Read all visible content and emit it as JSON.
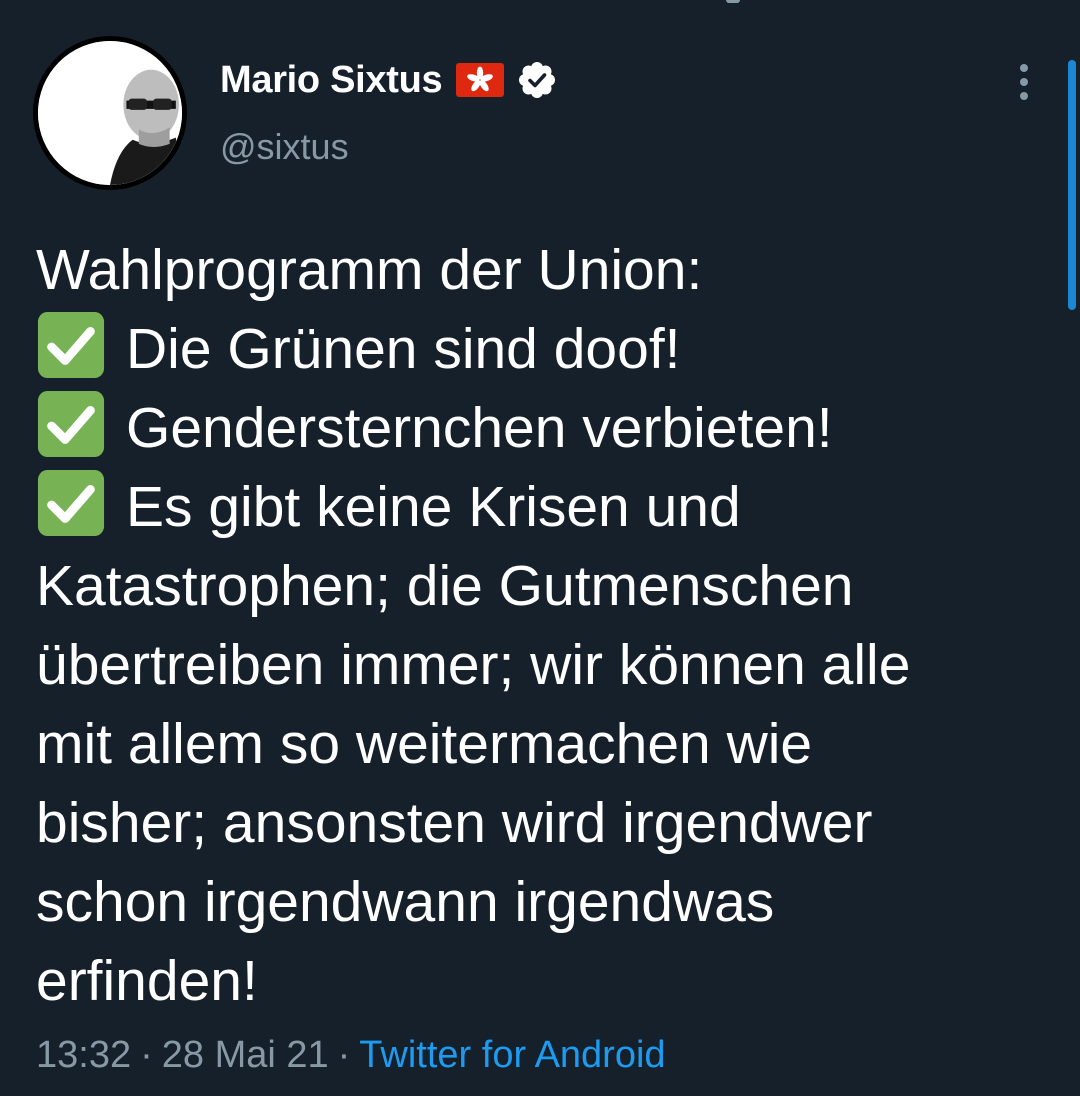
{
  "tweet": {
    "author": {
      "display_name": "Mario Sixtus",
      "handle": "@sixtus",
      "flag_icon": "hong-kong-flag-icon",
      "verified_icon": "verified-badge-icon"
    },
    "text_lines": [
      {
        "check": false,
        "text": "Wahlprogramm der Union:"
      },
      {
        "check": true,
        "text": "Die Grünen sind doof!"
      },
      {
        "check": true,
        "text": "Gendersternchen verbieten!"
      },
      {
        "check": true,
        "text": "Es gibt keine Krisen und"
      },
      {
        "check": false,
        "text": "Katastrophen; die Gutmenschen"
      },
      {
        "check": false,
        "text": "übertreiben immer; wir können alle"
      },
      {
        "check": false,
        "text": "mit allem so weitermachen wie"
      },
      {
        "check": false,
        "text": "bisher; ansonsten wird irgendwer"
      },
      {
        "check": false,
        "text": "schon irgendwann irgendwas"
      },
      {
        "check": false,
        "text": "erfinden!"
      }
    ],
    "time": "13:32",
    "separator": "·",
    "date": "28 Mai 21",
    "source": "Twitter for Android"
  },
  "colors": {
    "background": "#15202b",
    "text": "#ffffff",
    "secondary": "#8899a6",
    "link": "#1d9bf0",
    "check_green": "#77b255"
  }
}
